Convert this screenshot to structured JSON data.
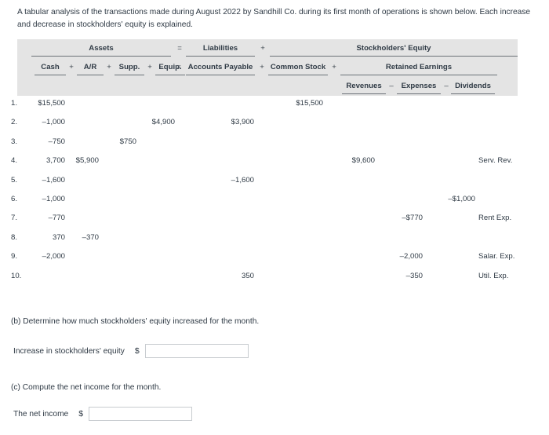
{
  "intro": "A tabular analysis of the transactions made during August 2022 by Sandhill Co. during its first month of operations is shown below. Each increase and decrease in stockholders' equity is explained.",
  "table": {
    "tier1": {
      "assets": "Assets",
      "eq_sign": "=",
      "liabilities": "Liabilities",
      "plus_sign": "+",
      "stockholders_equity": "Stockholders' Equity"
    },
    "tier2": {
      "cash": "Cash",
      "op1": "+",
      "ar": "A/R",
      "op2": "+",
      "supp": "Supp.",
      "op3": "+",
      "equip": "Equip.",
      "op4": "=",
      "accounts_payable": "Accounts Payable",
      "op5": "+",
      "common_stock": "Common Stock",
      "op6": "+",
      "retained_earnings": "Retained Earnings"
    },
    "tier3": {
      "revenues": "Revenues",
      "minus1": "–",
      "expenses": "Expenses",
      "minus2": "–",
      "dividends": "Dividends"
    },
    "rows": [
      {
        "idx": "1.",
        "cash": "$15,500",
        "ar": "",
        "supp": "",
        "equip": "",
        "ap": "",
        "cs": "$15,500",
        "rev": "",
        "exp": "",
        "div": "",
        "note": ""
      },
      {
        "idx": "2.",
        "cash": "–1,000",
        "ar": "",
        "supp": "",
        "equip": "$4,900",
        "ap": "$3,900",
        "cs": "",
        "rev": "",
        "exp": "",
        "div": "",
        "note": ""
      },
      {
        "idx": "3.",
        "cash": "–750",
        "ar": "",
        "supp": "$750",
        "equip": "",
        "ap": "",
        "cs": "",
        "rev": "",
        "exp": "",
        "div": "",
        "note": ""
      },
      {
        "idx": "4.",
        "cash": "3,700",
        "ar": "$5,900",
        "supp": "",
        "equip": "",
        "ap": "",
        "cs": "",
        "rev": "$9,600",
        "exp": "",
        "div": "",
        "note": "Serv. Rev."
      },
      {
        "idx": "5.",
        "cash": "–1,600",
        "ar": "",
        "supp": "",
        "equip": "",
        "ap": "–1,600",
        "cs": "",
        "rev": "",
        "exp": "",
        "div": "",
        "note": ""
      },
      {
        "idx": "6.",
        "cash": "–1,000",
        "ar": "",
        "supp": "",
        "equip": "",
        "ap": "",
        "cs": "",
        "rev": "",
        "exp": "",
        "div": "–$1,000",
        "note": ""
      },
      {
        "idx": "7.",
        "cash": "–770",
        "ar": "",
        "supp": "",
        "equip": "",
        "ap": "",
        "cs": "",
        "rev": "",
        "exp": "–$770",
        "div": "",
        "note": "Rent Exp."
      },
      {
        "idx": "8.",
        "cash": "370",
        "ar": "–370",
        "supp": "",
        "equip": "",
        "ap": "",
        "cs": "",
        "rev": "",
        "exp": "",
        "div": "",
        "note": ""
      },
      {
        "idx": "9.",
        "cash": "–2,000",
        "ar": "",
        "supp": "",
        "equip": "",
        "ap": "",
        "cs": "",
        "rev": "",
        "exp": "–2,000",
        "div": "",
        "note": "Salar. Exp."
      },
      {
        "idx": "10.",
        "cash": "",
        "ar": "",
        "supp": "",
        "equip": "",
        "ap": "350",
        "cs": "",
        "rev": "",
        "exp": "–350",
        "div": "",
        "note": "Util. Exp."
      }
    ]
  },
  "question_b": {
    "prompt": "(b) Determine how much stockholders' equity increased for the month.",
    "label": "Increase in stockholders' equity",
    "currency": "$",
    "value": "",
    "placeholder": ""
  },
  "question_c": {
    "prompt": "(c) Compute the net income for the month.",
    "label": "The net income",
    "currency": "$",
    "value": "",
    "placeholder": ""
  }
}
